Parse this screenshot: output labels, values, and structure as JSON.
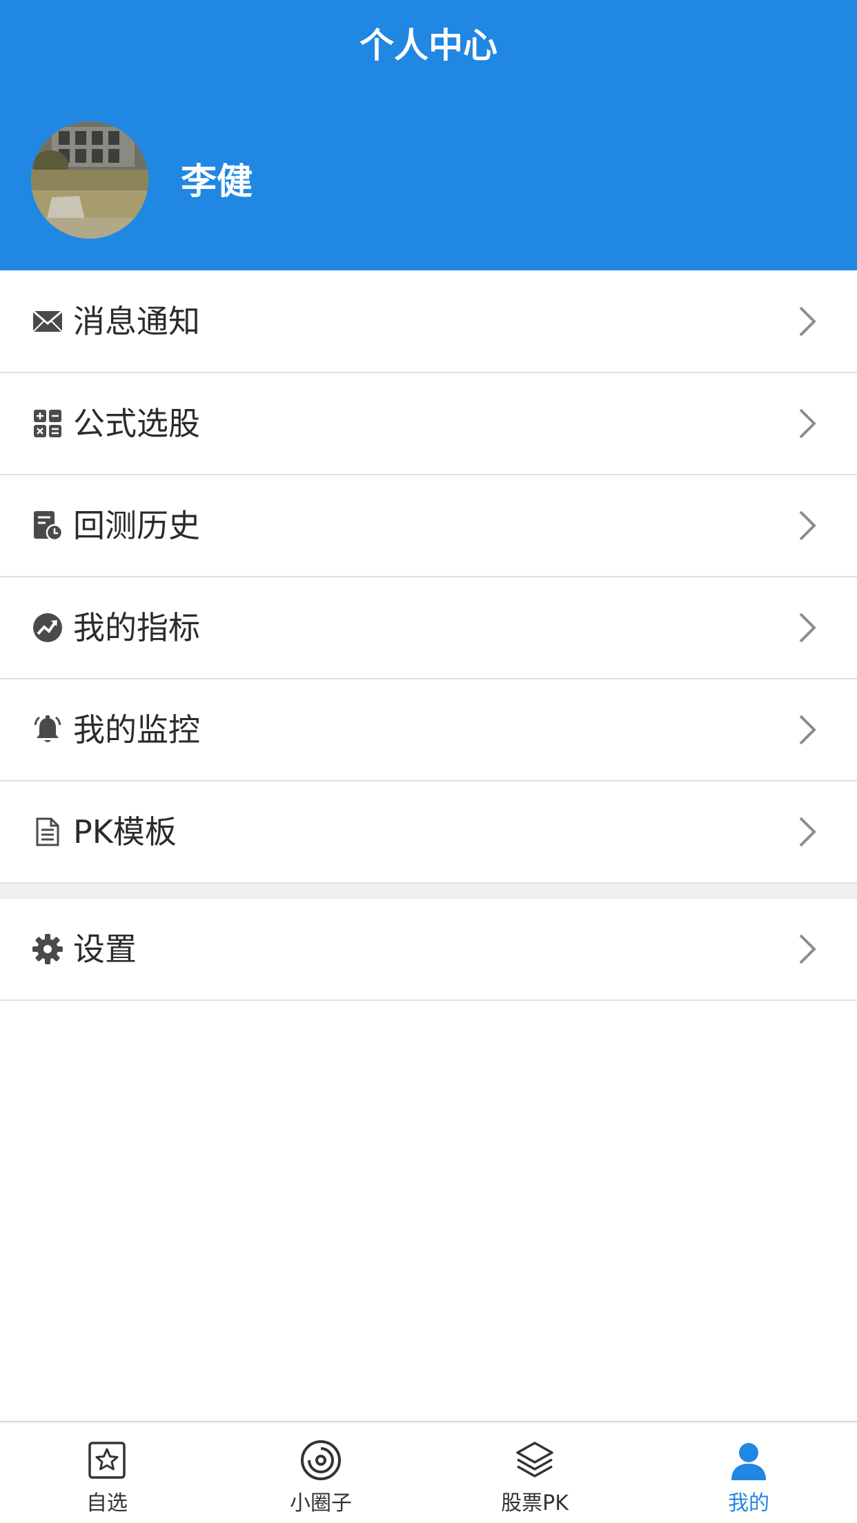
{
  "header": {
    "title": "个人中心",
    "username": "李健",
    "background_color": "#2087E2"
  },
  "menu": {
    "items": [
      {
        "label": "消息通知",
        "icon": "mail-icon"
      },
      {
        "label": "公式选股",
        "icon": "calculator-icon"
      },
      {
        "label": "回测历史",
        "icon": "history-icon"
      },
      {
        "label": "我的指标",
        "icon": "trend-icon"
      },
      {
        "label": "我的监控",
        "icon": "alarm-bell-icon"
      },
      {
        "label": "PK模板",
        "icon": "document-icon"
      },
      {
        "label": "设置",
        "icon": "gear-icon"
      }
    ]
  },
  "tabbar": {
    "tabs": [
      {
        "label": "自选",
        "icon": "star-box-icon",
        "active": false
      },
      {
        "label": "小圈子",
        "icon": "circle-target-icon",
        "active": false
      },
      {
        "label": "股票PK",
        "icon": "layers-icon",
        "active": false
      },
      {
        "label": "我的",
        "icon": "person-icon",
        "active": true
      }
    ],
    "active_color": "#2087E2"
  }
}
